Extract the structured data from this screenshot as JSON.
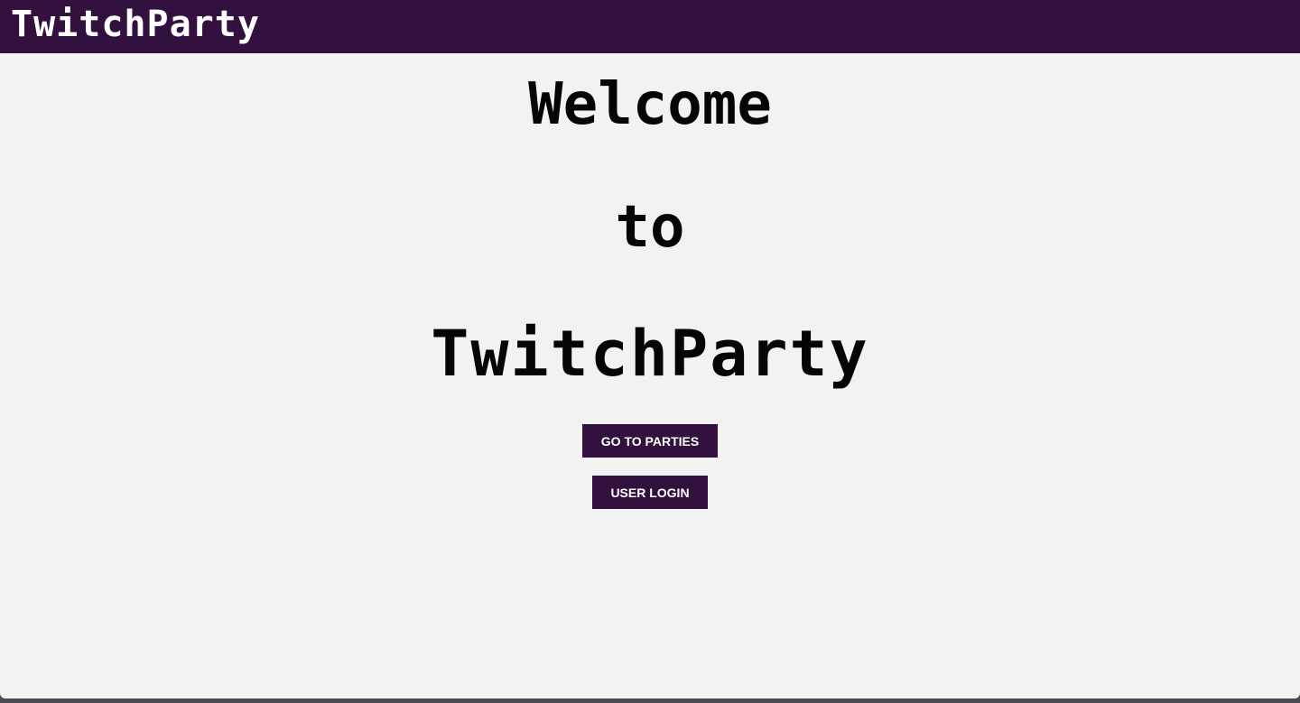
{
  "navbar": {
    "brand": "TwitchParty",
    "background": "#32113f"
  },
  "hero": {
    "line1": "Welcome",
    "line2": "to",
    "line3": "TwitchParty"
  },
  "actions": {
    "parties_label": "GO TO PARTIES",
    "login_label": "USER LOGIN",
    "button_color": "#32113f"
  },
  "colors": {
    "page_background": "#f2f2f2",
    "text": "#050505"
  }
}
